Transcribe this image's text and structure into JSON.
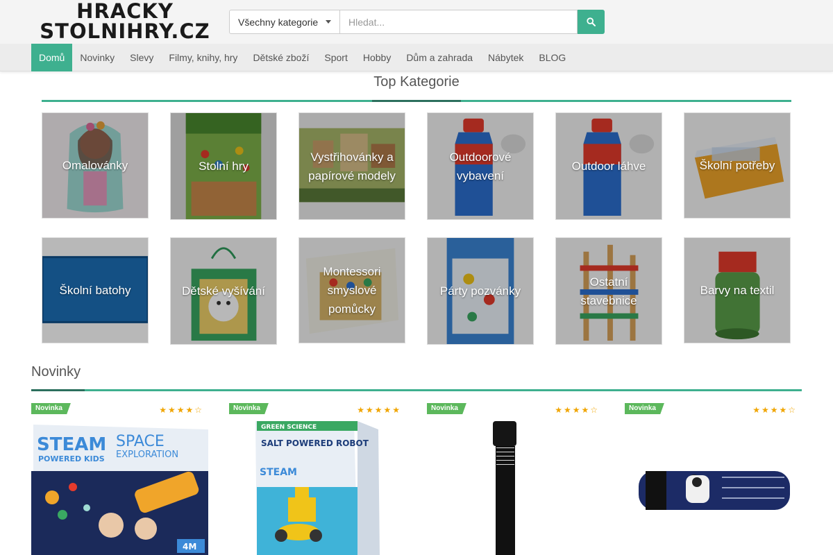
{
  "header": {
    "logo_line1": "HRACKY",
    "logo_line2": "STOLNIHRY.CZ",
    "category_select": "Všechny kategorie",
    "search_placeholder": "Hledat...",
    "search_icon": "search-icon"
  },
  "nav": {
    "items": [
      "Domů",
      "Novinky",
      "Slevy",
      "Filmy, knihy, hry",
      "Dětské zboží",
      "Sport",
      "Hobby",
      "Dům a zahrada",
      "Nábytek",
      "BLOG"
    ],
    "active_index": 0
  },
  "top_categories": {
    "title": "Top Kategorie",
    "items": [
      "Omalovánky",
      "Stolní hry",
      "Vystřihovánky a papírové modely",
      "Outdoorové vybavení",
      "Outdoor láhve",
      "Školní potřeby",
      "Školní batohy",
      "Dětské vyšívání",
      "Montessori smyslové pomůcky",
      "Párty pozvánky",
      "Ostatní stavebnice",
      "Barvy na textil"
    ]
  },
  "novinky": {
    "title": "Novinky",
    "products": [
      {
        "badge": "Novinka",
        "rating": 4,
        "stars": "★★★★☆"
      },
      {
        "badge": "Novinka",
        "rating": 5,
        "stars": "★★★★★"
      },
      {
        "badge": "Novinka",
        "rating": 4,
        "stars": "★★★★☆"
      },
      {
        "badge": "Novinka",
        "rating": 4,
        "stars": "★★★★☆"
      }
    ],
    "image_texts": {
      "p1_a": "STEAM",
      "p1_b": "POWERED KIDS",
      "p1_c": "SPACE",
      "p1_d": "EXPLORATION",
      "p1_e": "4M",
      "p2_a": "GREEN SCIENCE",
      "p2_b": "SALT POWERED ROBOT",
      "p2_c": "STEAM"
    }
  },
  "colors": {
    "accent": "#3eb08f",
    "accent_dark": "#2c6f5d",
    "badge": "#5cb85c",
    "star": "#f0a500"
  }
}
